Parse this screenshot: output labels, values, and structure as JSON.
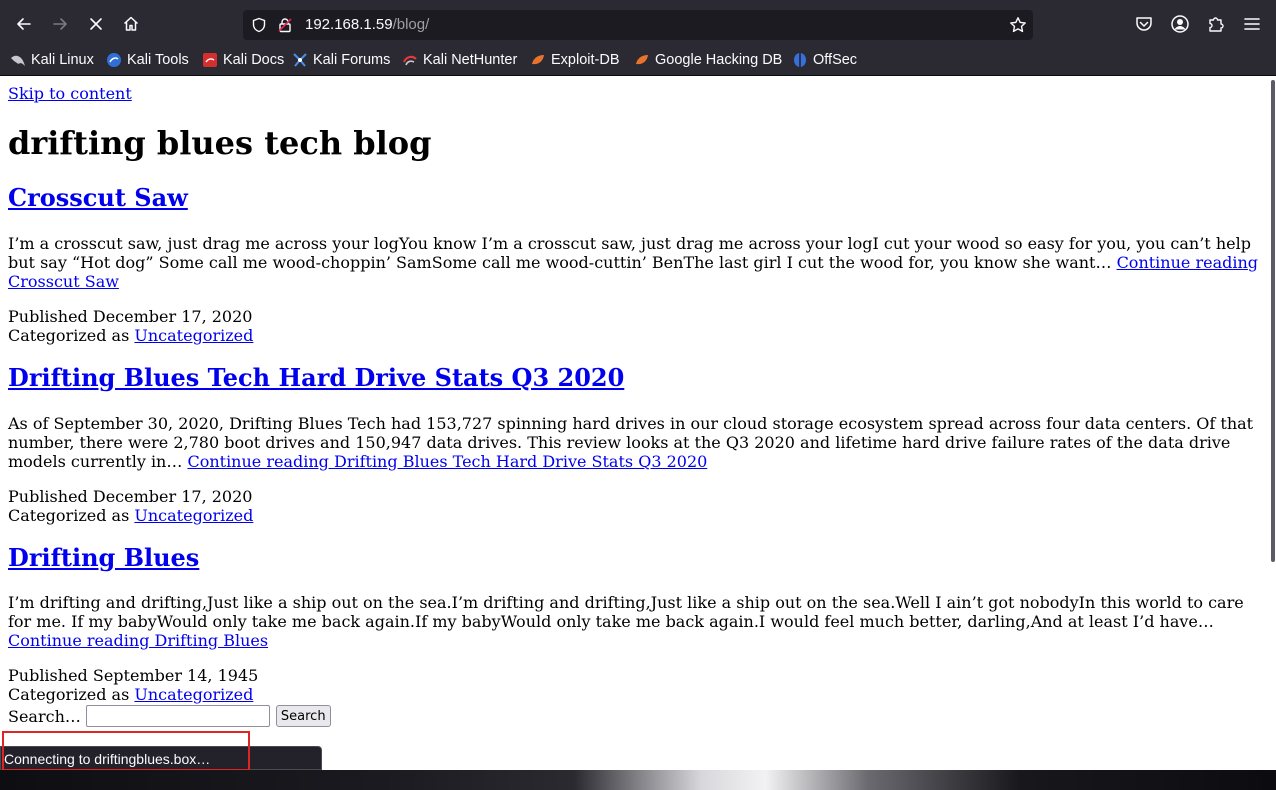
{
  "browser": {
    "url_host": "192.168.1.59",
    "url_path": "/blog/",
    "bookmarks": [
      {
        "label": "Kali Linux",
        "icon": "kali-dragon-icon"
      },
      {
        "label": "Kali Tools",
        "icon": "kali-tools-icon"
      },
      {
        "label": "Kali Docs",
        "icon": "kali-docs-icon"
      },
      {
        "label": "Kali Forums",
        "icon": "kali-forums-icon"
      },
      {
        "label": "Kali NetHunter",
        "icon": "kali-nethunter-icon"
      },
      {
        "label": "Exploit-DB",
        "icon": "exploit-db-icon"
      },
      {
        "label": "Google Hacking DB",
        "icon": "google-hacking-db-icon"
      },
      {
        "label": "OffSec",
        "icon": "offsec-icon"
      }
    ],
    "status": "Connecting to driftingblues.box…"
  },
  "page": {
    "skip_link": "Skip to content",
    "site_title": "drifting blues tech blog",
    "posts": [
      {
        "title": "Crosscut Saw",
        "excerpt": "I’m a crosscut saw, just drag me across your logYou know I’m a crosscut saw, just drag me across your logI cut your wood so easy for you, you can’t help but say “Hot dog” Some call me wood-choppin’ SamSome call me wood-cuttin’ BenThe last girl I cut the wood for, you know she want… ",
        "continue": "Continue reading Crosscut Saw",
        "published": "Published December 17, 2020",
        "categorized_label": "Categorized as ",
        "category": "Uncategorized"
      },
      {
        "title": "Drifting Blues Tech Hard Drive Stats Q3 2020",
        "excerpt": "As of September 30, 2020, Drifting Blues Tech had 153,727 spinning hard drives in our cloud storage ecosystem spread across four data centers. Of that number, there were 2,780 boot drives and 150,947 data drives. This review looks at the Q3 2020 and lifetime hard drive failure rates of the data drive models currently in… ",
        "continue": "Continue reading Drifting Blues Tech Hard Drive Stats Q3 2020",
        "published": "Published December 17, 2020",
        "categorized_label": "Categorized as ",
        "category": "Uncategorized"
      },
      {
        "title": "Drifting Blues",
        "excerpt": "I’m drifting and drifting,Just like a ship out on the sea.I’m drifting and drifting,Just like a ship out on the sea.Well I ain’t got nobodyIn this world to care for me. If my babyWould only take me back again.If my babyWould only take me back again.I would feel much better, darling,And at least I’d have… ",
        "continue": "Continue reading Drifting Blues",
        "published": "Published September 14, 1945",
        "categorized_label": "Categorized as ",
        "category": "Uncategorized"
      }
    ],
    "search_label": "Search…",
    "search_value": "",
    "search_button": "Search"
  }
}
